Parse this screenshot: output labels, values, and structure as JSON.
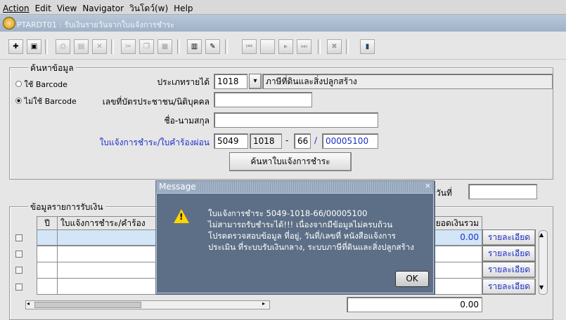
{
  "menu": [
    "Action",
    "Edit",
    "View",
    "Navigator",
    "วินโดว์(w)",
    "Help"
  ],
  "window_title": "PTARDT01 : รับเงินรายวันจากใบแจ้งการชำระ",
  "search": {
    "group_title": "ค้นหาข้อมูล",
    "radio_barcode": "ใช้ Barcode",
    "radio_no_barcode": "ไม่ใช้ Barcode",
    "income_type_label": "ประเภทรายได้",
    "income_type_code": "1018",
    "income_type_name": "ภาษีที่ดินและสิ่งปลูกสร้าง",
    "id_card_label": "เลขที่บัตรประชาชน/นิติบุคคล",
    "id_card_value": "",
    "name_label": "ชื่อ-นามสกุล",
    "name_value": "",
    "bill_label": "ใบแจ้งการชำระ/ใบคำร้องผ่อน",
    "bill_part1": "5049",
    "bill_part2": "1018",
    "bill_dash": "-",
    "bill_part3": "66",
    "bill_slash": "/",
    "bill_part4": "00005100",
    "search_button": "ค้นหาใบแจ้งการชำระ",
    "date_label": "วันที่",
    "date_value": ""
  },
  "payments": {
    "group_title": "ข้อมูลรายการรับเงิน",
    "col_pi": "ปี",
    "col_bill": "ใบแจ้งการชำระ/คำร้อง",
    "col_total": "ยอดเงินรวม",
    "rows": [
      {
        "total": "0.00",
        "detail": "รายละเอียด"
      },
      {
        "total": "",
        "detail": "รายละเอียด"
      },
      {
        "total": "",
        "detail": "รายละเอียด"
      },
      {
        "total": "",
        "detail": "รายละเอียด"
      }
    ],
    "grand_total": "0.00"
  },
  "dialog": {
    "title": "Message",
    "close": "×",
    "line1": "ใบแจ้งการชำระ 5049-1018-66/00005100",
    "line2": "ไม่สามารถรับชำระได้!!! เนื่องจากมีข้อมูลไม่ครบถ้วน",
    "line3": "โปรดตรวจสอบข้อมูล ที่อยู่, วันที่/เลขที่ หนังสือแจ้งการ",
    "line4": "ประเมิน ที่ระบบรับเงินกลาง, ระบบภาษีที่ดินและสิ่งปลูกสร้าง",
    "ok": "OK"
  }
}
